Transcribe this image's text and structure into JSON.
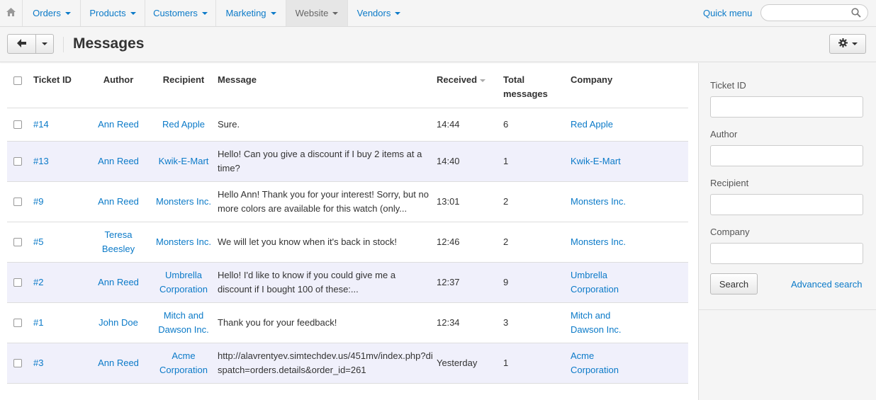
{
  "nav": {
    "items": [
      {
        "label": "Orders"
      },
      {
        "label": "Products"
      },
      {
        "label": "Customers"
      },
      {
        "label": "Marketing"
      },
      {
        "label": "Website"
      },
      {
        "label": "Vendors"
      }
    ],
    "quick_menu": "Quick menu",
    "search_placeholder": ""
  },
  "header": {
    "title": "Messages"
  },
  "table": {
    "columns": {
      "ticket_id": "Ticket ID",
      "author": "Author",
      "recipient": "Recipient",
      "message": "Message",
      "received": "Received",
      "total_messages": "Total messages",
      "company": "Company"
    },
    "rows": [
      {
        "ticket": "#14",
        "author": "Ann Reed",
        "recipient": "Red Apple",
        "message": "Sure.",
        "received": "14:44",
        "total": "6",
        "company": "Red Apple"
      },
      {
        "ticket": "#13",
        "author": "Ann Reed",
        "recipient": "Kwik-E-Mart",
        "message": "Hello! Can you give a discount if I buy 2 items at a time?",
        "received": "14:40",
        "total": "1",
        "company": "Kwik-E-Mart"
      },
      {
        "ticket": "#9",
        "author": "Ann Reed",
        "recipient": "Monsters Inc.",
        "message": "Hello Ann! Thank you for your interest! Sorry, but no more colors are available for this watch (only...",
        "received": "13:01",
        "total": "2",
        "company": "Monsters Inc."
      },
      {
        "ticket": "#5",
        "author": "Teresa Beesley",
        "recipient": "Monsters Inc.",
        "message": "We will let you know when it's back in stock!",
        "received": "12:46",
        "total": "2",
        "company": "Monsters Inc."
      },
      {
        "ticket": "#2",
        "author": "Ann Reed",
        "recipient": "Umbrella Corporation",
        "message": "Hello! I'd like to know if you could give me a discount if I bought 100 of these:...",
        "received": "12:37",
        "total": "9",
        "company": "Umbrella Corporation"
      },
      {
        "ticket": "#1",
        "author": "John Doe",
        "recipient": "Mitch and Dawson Inc.",
        "message": "Thank you for your feedback!",
        "received": "12:34",
        "total": "3",
        "company": "Mitch and Dawson Inc."
      },
      {
        "ticket": "#3",
        "author": "Ann Reed",
        "recipient": "Acme Corporation",
        "message": "http://alavrentyev.simtechdev.us/451mv/index.php?dispatch=orders.details&order_id=261",
        "received": "Yesterday",
        "total": "1",
        "company": "Acme Corporation"
      }
    ]
  },
  "sidebar": {
    "ticket_id_label": "Ticket ID",
    "author_label": "Author",
    "recipient_label": "Recipient",
    "company_label": "Company",
    "search_button": "Search",
    "advanced_search": "Advanced search"
  },
  "colors": {
    "link": "#0b7ac8",
    "alt_row": "#f0f0fb",
    "toolbar_bg": "#f5f5f5"
  }
}
